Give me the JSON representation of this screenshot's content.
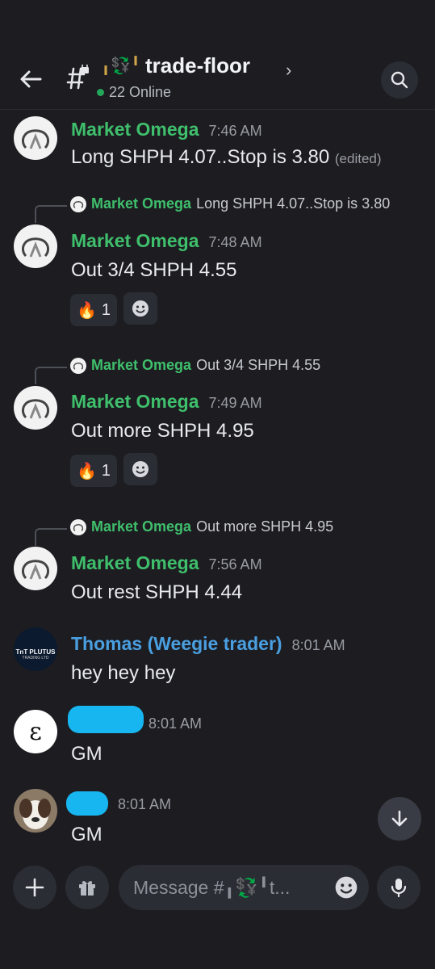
{
  "header": {
    "back_icon": "arrow-left-icon",
    "channel_icon": "hash-lock-icon",
    "channel_prefix": "╻💱╹",
    "channel_name": "trade-floor",
    "chevron": "›",
    "online_text": "22 Online",
    "search_icon": "search-icon"
  },
  "messages": [
    {
      "author": "Market Omega",
      "time": "7:46 AM",
      "text": "Long SHPH 4.07..Stop is 3.80",
      "edited": "(edited)"
    },
    {
      "reply_author": "Market Omega",
      "reply_text": "Long SHPH 4.07..Stop is 3.80",
      "author": "Market Omega",
      "time": "7:48 AM",
      "text": "Out 3/4 SHPH 4.55",
      "reaction_emoji": "🔥",
      "reaction_count": "1"
    },
    {
      "reply_author": "Market Omega",
      "reply_text": "Out 3/4 SHPH 4.55",
      "author": "Market Omega",
      "time": "7:49 AM",
      "text": "Out more SHPH 4.95",
      "reaction_emoji": "🔥",
      "reaction_count": "1"
    },
    {
      "reply_author": "Market Omega",
      "reply_text": "Out more SHPH 4.95",
      "author": "Market Omega",
      "time": "7:56 AM",
      "text": "Out rest SHPH 4.44"
    },
    {
      "author": "Thomas (Weegie trader)",
      "time": "8:01 AM",
      "text": "hey hey hey",
      "avatar_text": "TnT PLUTUS",
      "avatar_sub": "TRADING LTD"
    },
    {
      "author": "",
      "time": "8:01 AM",
      "text": "GM",
      "avatar_text": "ε"
    },
    {
      "author": "",
      "time": "8:01 AM",
      "text": "GM"
    }
  ],
  "composer": {
    "placeholder": "Message #╻💱╹t...",
    "add_icon": "plus-icon",
    "gift_icon": "gift-icon",
    "emoji_icon": "emoji-icon",
    "mic_icon": "microphone-icon"
  },
  "scroll_icon": "arrow-down-icon",
  "colors": {
    "background": "#1c1c21",
    "author_green": "#3fbf6c",
    "author_blue": "#4a9fe0",
    "online_green": "#23a55a",
    "redaction": "#17b6f0"
  }
}
